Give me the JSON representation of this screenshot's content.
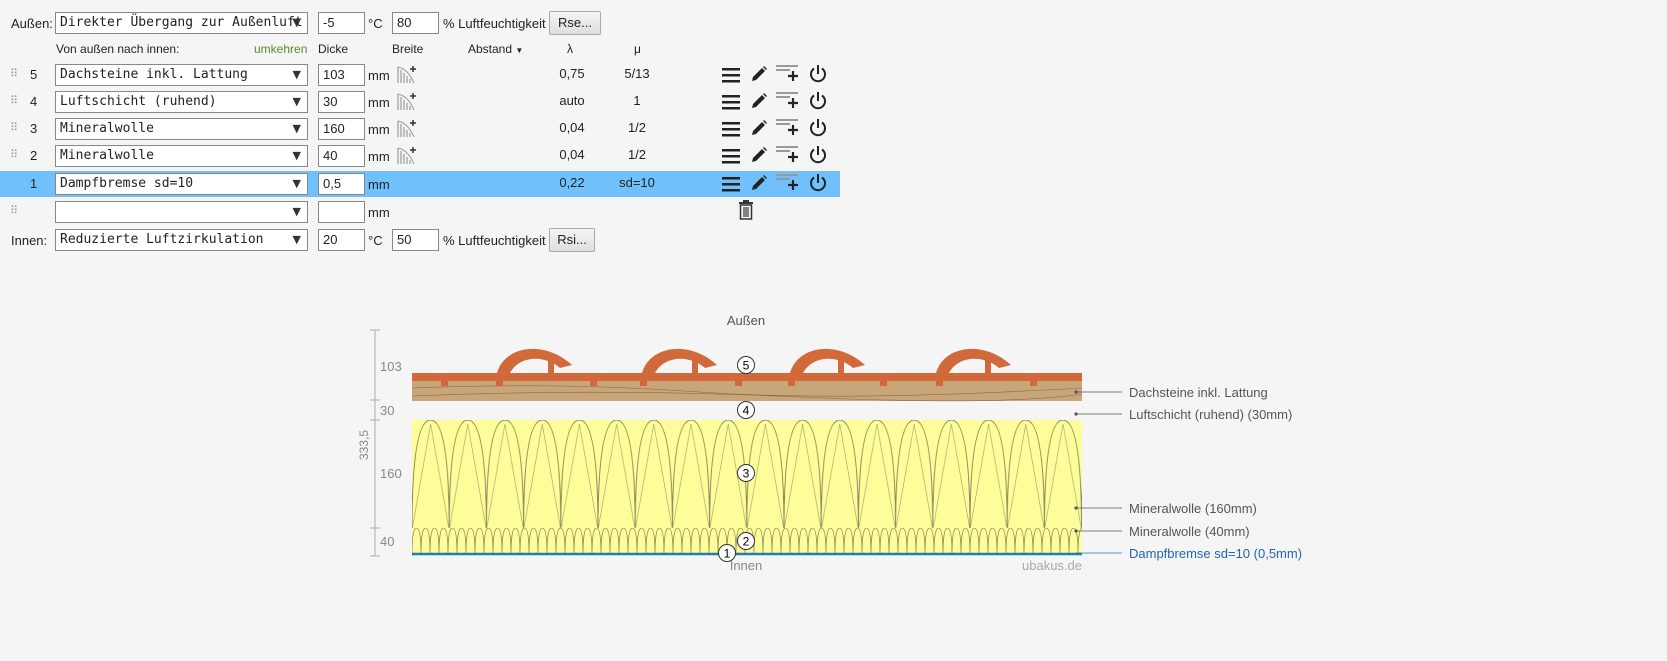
{
  "outside": {
    "label": "Außen:",
    "select": "Direkter Übergang zur Außenluft",
    "temp": "-5",
    "temp_unit": "°C",
    "humidity": "80",
    "humidity_unit": "% Luftfeuchtigkeit",
    "button": "Rse..."
  },
  "header": {
    "order": "Von außen nach innen:",
    "reverse": "umkehren",
    "thickness": "Dicke",
    "width": "Breite",
    "distance": "Abstand",
    "lambda": "λ",
    "mu": "μ"
  },
  "layers": [
    {
      "num": "5",
      "name": "Dachsteine inkl. Lattung",
      "thickness": "103",
      "unit": "mm",
      "lambda": "0,75",
      "mu": "5/13",
      "selected": false
    },
    {
      "num": "4",
      "name": "Luftschicht (ruhend)",
      "thickness": "30",
      "unit": "mm",
      "lambda": "auto",
      "mu": "1",
      "selected": false
    },
    {
      "num": "3",
      "name": "Mineralwolle",
      "thickness": "160",
      "unit": "mm",
      "lambda": "0,04",
      "mu": "1/2",
      "selected": false
    },
    {
      "num": "2",
      "name": "Mineralwolle",
      "thickness": "40",
      "unit": "mm",
      "lambda": "0,04",
      "mu": "1/2",
      "selected": false
    },
    {
      "num": "1",
      "name": "Dampfbremse sd=10",
      "thickness": "0,5",
      "unit": "mm",
      "lambda": "0,22",
      "mu": "sd=10",
      "selected": true
    }
  ],
  "empty_row": {
    "name": "",
    "thickness": "",
    "unit": "mm"
  },
  "inside": {
    "label": "Innen:",
    "select": "Reduzierte Luftzirkulation",
    "temp": "20",
    "temp_unit": "°C",
    "humidity": "50",
    "humidity_unit": "% Luftfeuchtigkeit",
    "button": "Rsi..."
  },
  "diagram": {
    "top_label": "Außen",
    "bottom_label": "Innen",
    "watermark": "ubakus.de",
    "total": "333,5",
    "dims": [
      "103",
      "30",
      "160",
      "40"
    ],
    "markers": [
      "5",
      "4",
      "3",
      "2",
      "1"
    ],
    "legend": [
      "Dachsteine inkl. Lattung",
      "Luftschicht (ruhend) (30mm)",
      "Mineralwolle (160mm)",
      "Mineralwolle (40mm)",
      "Dampfbremse sd=10 (0,5mm)"
    ],
    "colors": {
      "tile": "#d2693a",
      "wood": "#c9a57a",
      "wool": "#fdfd9a",
      "membrane": "#1f7ab8",
      "highlight": "#70c0fb",
      "reverse": "#5a8a2a"
    }
  }
}
